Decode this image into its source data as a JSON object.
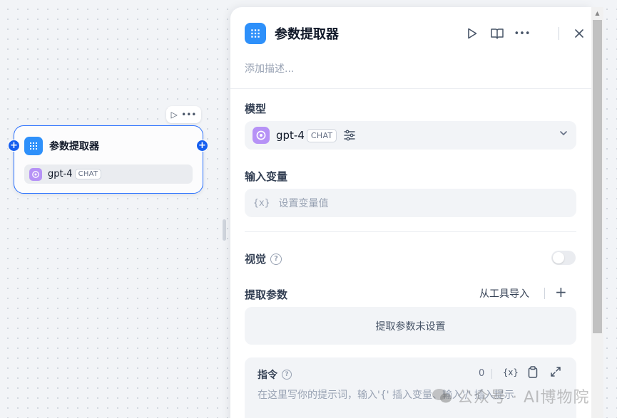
{
  "node": {
    "title": "参数提取器",
    "model_name": "gpt-4",
    "model_badge": "CHAT"
  },
  "panel": {
    "title": "参数提取器",
    "description_placeholder": "添加描述...",
    "model_label": "模型",
    "model_name": "gpt-4",
    "model_badge": "CHAT",
    "input_var_label": "输入变量",
    "input_var_brace": "{x}",
    "input_var_placeholder": "设置变量值",
    "vision_label": "视觉",
    "vision_enabled": false,
    "extract_label": "提取参数",
    "import_from_tool": "从工具导入",
    "extract_empty": "提取参数未设置",
    "prompt_label": "指令",
    "prompt_count": "0",
    "prompt_var_icon": "{x}",
    "prompt_placeholder": "在这里写你的提示词，输入'{' 插入变量、输入'/' 插入提示"
  },
  "watermark": "公众号 · AI博物院",
  "colors": {
    "accent": "#2970ff",
    "node_icon": "#2e90fa",
    "gpt_icon": "#b692f6"
  },
  "icons": {
    "node_icon": "parameter-extractor-icon",
    "run": "play-icon",
    "docs": "book-icon",
    "more": "more-horizontal-icon",
    "close": "close-icon",
    "model": "openai-icon",
    "settings": "sliders-icon",
    "dropdown": "chevron-down-icon",
    "help": "question-circle-icon",
    "add": "plus-icon",
    "copy": "clipboard-icon",
    "expand": "expand-icon"
  }
}
